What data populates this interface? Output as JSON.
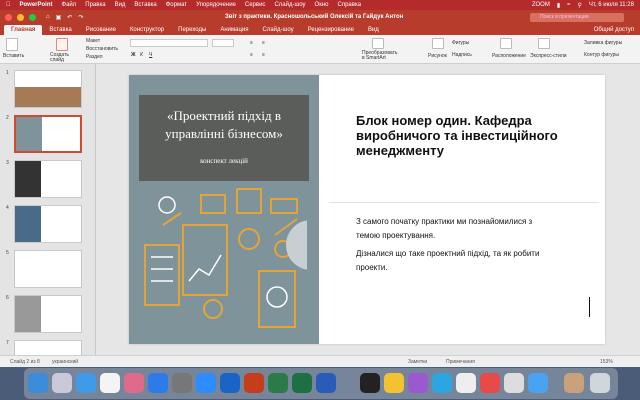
{
  "menubar": {
    "app_name": "PowerPoint",
    "items": [
      "Файл",
      "Правка",
      "Вид",
      "Вставка",
      "Формат",
      "Упорядочение",
      "Сервис",
      "Слайд-шоу",
      "Окно",
      "Справка"
    ],
    "zoom_label": "ZOOM",
    "clock": "Чт, 6 июля  11:28"
  },
  "window": {
    "title": "Звіт з практики. Красношольський Олексій та Гайдук Антон",
    "search_placeholder": "Поиск в презентации"
  },
  "ribbon_tabs": [
    "Главная",
    "Вставка",
    "Рисование",
    "Конструктор",
    "Переходы",
    "Анимация",
    "Слайд-шоу",
    "Рецензирование",
    "Вид"
  ],
  "active_tab": "Главная",
  "share_label": "Общий доступ",
  "ribbon": {
    "paste": "Вставить",
    "new_slide": "Создать слайд",
    "layout": "Макет",
    "reset": "Восстановить",
    "section": "Раздел",
    "smartart": "Преобразовать в SmartArt",
    "picture": "Рисунок",
    "shapes": "Фигуры",
    "textbox": "Надпись",
    "arrange": "Расположение",
    "quick_styles": "Экспресс-стили",
    "shape_fill": "Заливка фигуры",
    "shape_outline": "Контур фигуры"
  },
  "thumbnails": [
    {
      "num": "1"
    },
    {
      "num": "2"
    },
    {
      "num": "3"
    },
    {
      "num": "4"
    },
    {
      "num": "5"
    },
    {
      "num": "6"
    },
    {
      "num": "7"
    }
  ],
  "slide": {
    "cover_title": "«Проектний підхід в управлінні бізнесом»",
    "cover_subtitle": "конспект лекцій",
    "heading": "Блок номер один. Кафедра виробничого та інвестиційного менеджменту",
    "para1": "З самого початку практики ми познайомилися з темою проектування.",
    "para2": "Дізналися що таке проектний підхід, та як робити проекти."
  },
  "status": {
    "slide_info": "Слайд 2 из 8",
    "language": "украинский",
    "notes": "Заметки",
    "comments": "Примечания",
    "zoom": "153%"
  },
  "colors": {
    "accent": "#b83c2c",
    "cover_bg": "#7f949a",
    "cover_dark": "#5b5d5a",
    "icon_orange": "#e3a43a"
  }
}
